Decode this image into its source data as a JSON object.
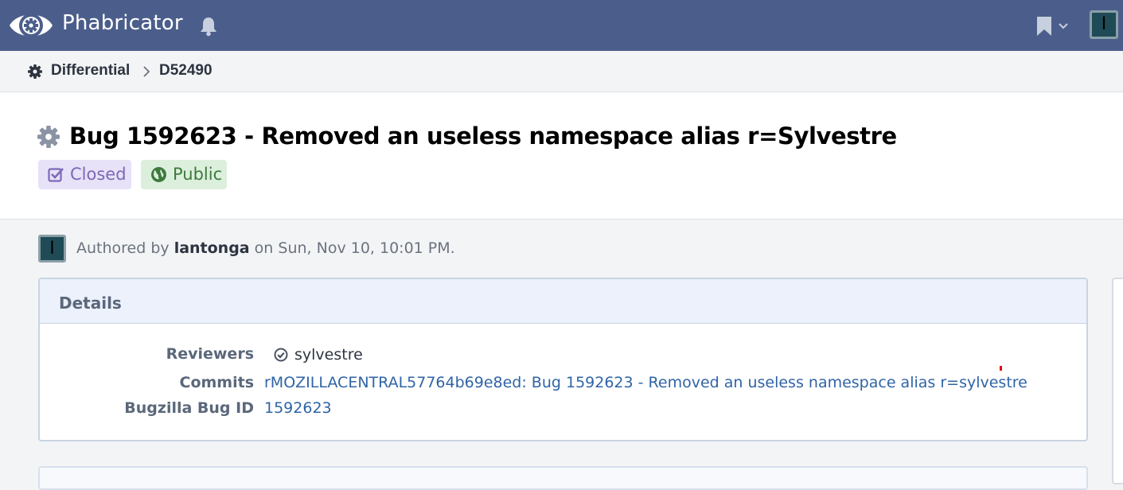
{
  "topbar": {
    "brand": "Phabricator",
    "user_initial": "I",
    "icons": {
      "logo": "phabricator-eye-logo",
      "notifications": "bell-icon",
      "bookmarks": "bookmark-icon",
      "menu": "chevron-down-icon"
    }
  },
  "breadcrumb": {
    "app": "Differential",
    "revision": "D52490"
  },
  "revision": {
    "title": "Bug 1592623 - Removed an useless namespace alias r=Sylvestre",
    "status_tag": "Closed",
    "visibility_tag": "Public"
  },
  "author": {
    "initial": "I",
    "prefix": "Authored by ",
    "name": "lantonga",
    "suffix": " on Sun, Nov 10, 10:01 PM."
  },
  "details": {
    "heading": "Details",
    "reviewers_label": "Reviewers",
    "reviewer": "sylvestre",
    "commits_label": "Commits",
    "commit": "rMOZILLACENTRAL57764b69e8ed: Bug 1592623 - Removed an useless namespace alias r=sylvestre",
    "bug_label": "Bugzilla Bug ID",
    "bug_id": "1592623"
  },
  "colors": {
    "topbar": "#4b5e8b",
    "closed_tag_bg": "#e7e2f7",
    "public_tag_bg": "#dcefdc",
    "link": "#2f64a6"
  }
}
